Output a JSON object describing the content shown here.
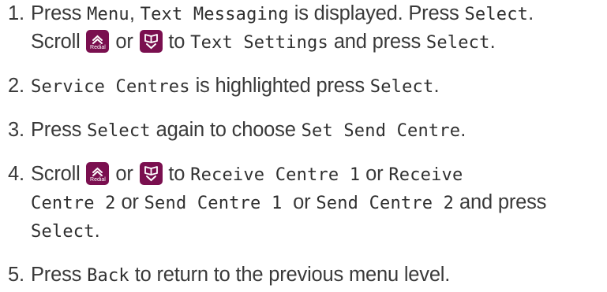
{
  "steps": [
    {
      "number": "1.",
      "lines": [
        [
          {
            "t": "Press "
          },
          {
            "m": "Menu"
          },
          {
            "t": ", "
          },
          {
            "m": "Text Messaging"
          },
          {
            "t": " is displayed. Press "
          },
          {
            "m": "Select"
          },
          {
            "t": "."
          }
        ],
        [
          {
            "t": "Scroll "
          },
          {
            "icon": "redial-up-key",
            "label": "Redial"
          },
          {
            "t": " or "
          },
          {
            "icon": "phonebook-down-key"
          },
          {
            "t": " to "
          },
          {
            "m": "Text Settings"
          },
          {
            "t": " and press "
          },
          {
            "m": "Select"
          },
          {
            "t": "."
          }
        ]
      ]
    },
    {
      "number": "2.",
      "lines": [
        [
          {
            "m": "Service Centres"
          },
          {
            "t": " is highlighted press "
          },
          {
            "m": "Select"
          },
          {
            "t": "."
          }
        ]
      ]
    },
    {
      "number": "3.",
      "lines": [
        [
          {
            "t": "Press "
          },
          {
            "m": "Select"
          },
          {
            "t": " again to choose "
          },
          {
            "m": "Set Send Centre"
          },
          {
            "t": "."
          }
        ]
      ]
    },
    {
      "number": "4.",
      "lines": [
        [
          {
            "t": "Scroll "
          },
          {
            "icon": "redial-up-key",
            "label": "Redial"
          },
          {
            "t": " or "
          },
          {
            "icon": "phonebook-down-key"
          },
          {
            "t": " to "
          },
          {
            "m": "Receive Centre 1"
          },
          {
            "t": " or "
          },
          {
            "m": "Receive"
          }
        ],
        [
          {
            "m": "Centre 2"
          },
          {
            "t": " or "
          },
          {
            "m": "Send Centre 1"
          },
          {
            "t": "  or "
          },
          {
            "m": "Send Centre 2"
          },
          {
            "t": " and press"
          }
        ],
        [
          {
            "m": "Select"
          },
          {
            "t": "."
          }
        ]
      ]
    },
    {
      "number": "5.",
      "lines": [
        [
          {
            "t": "Press "
          },
          {
            "m": "Back"
          },
          {
            "t": " to return to the previous menu level."
          }
        ]
      ]
    }
  ]
}
